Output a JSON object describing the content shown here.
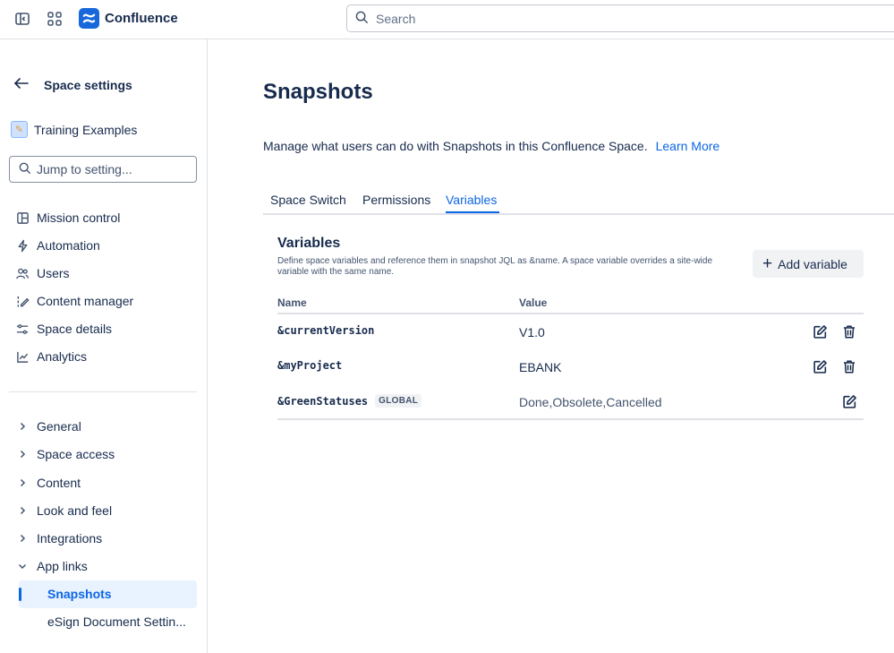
{
  "app": {
    "name": "Confluence"
  },
  "search": {
    "placeholder": "Search"
  },
  "sidebar": {
    "back_label": "Space settings",
    "space_name": "Training Examples",
    "jump_placeholder": "Jump to setting...",
    "nav": [
      {
        "label": "Mission control",
        "icon": "layout-icon"
      },
      {
        "label": "Automation",
        "icon": "lightning-icon"
      },
      {
        "label": "Users",
        "icon": "people-icon"
      },
      {
        "label": "Content manager",
        "icon": "content-manager-icon"
      },
      {
        "label": "Space details",
        "icon": "sliders-icon"
      },
      {
        "label": "Analytics",
        "icon": "chart-icon"
      }
    ],
    "tree": [
      {
        "label": "General",
        "expanded": false
      },
      {
        "label": "Space access",
        "expanded": false
      },
      {
        "label": "Content",
        "expanded": false
      },
      {
        "label": "Look and feel",
        "expanded": false
      },
      {
        "label": "Integrations",
        "expanded": false
      },
      {
        "label": "App links",
        "expanded": true
      }
    ],
    "app_links_children": [
      {
        "label": "Snapshots",
        "active": true
      },
      {
        "label": "eSign Document Settin..."
      }
    ]
  },
  "main": {
    "title": "Snapshots",
    "description": "Manage what users can do with Snapshots in this Confluence Space.",
    "learn_more": "Learn More",
    "tabs": [
      {
        "label": "Space Switch"
      },
      {
        "label": "Permissions"
      },
      {
        "label": "Variables",
        "active": true
      }
    ],
    "variables": {
      "title": "Variables",
      "description": "Define space variables and reference them in snapshot JQL as &name. A space variable overrides a site-wide variable with the same name.",
      "add_button": "Add variable",
      "columns": {
        "name": "Name",
        "value": "Value"
      },
      "rows": [
        {
          "name": "&currentVersion",
          "value": "V1.0",
          "global": false
        },
        {
          "name": "&myProject",
          "value": "EBANK",
          "global": false
        },
        {
          "name": "&GreenStatuses",
          "value": "Done,Obsolete,Cancelled",
          "global": true,
          "badge": "GLOBAL"
        }
      ]
    }
  },
  "colors": {
    "accent": "#0c66e4",
    "brand": "#1868db",
    "text": "#172b4d",
    "subtle": "#44546f",
    "border": "#dfe1e6"
  }
}
